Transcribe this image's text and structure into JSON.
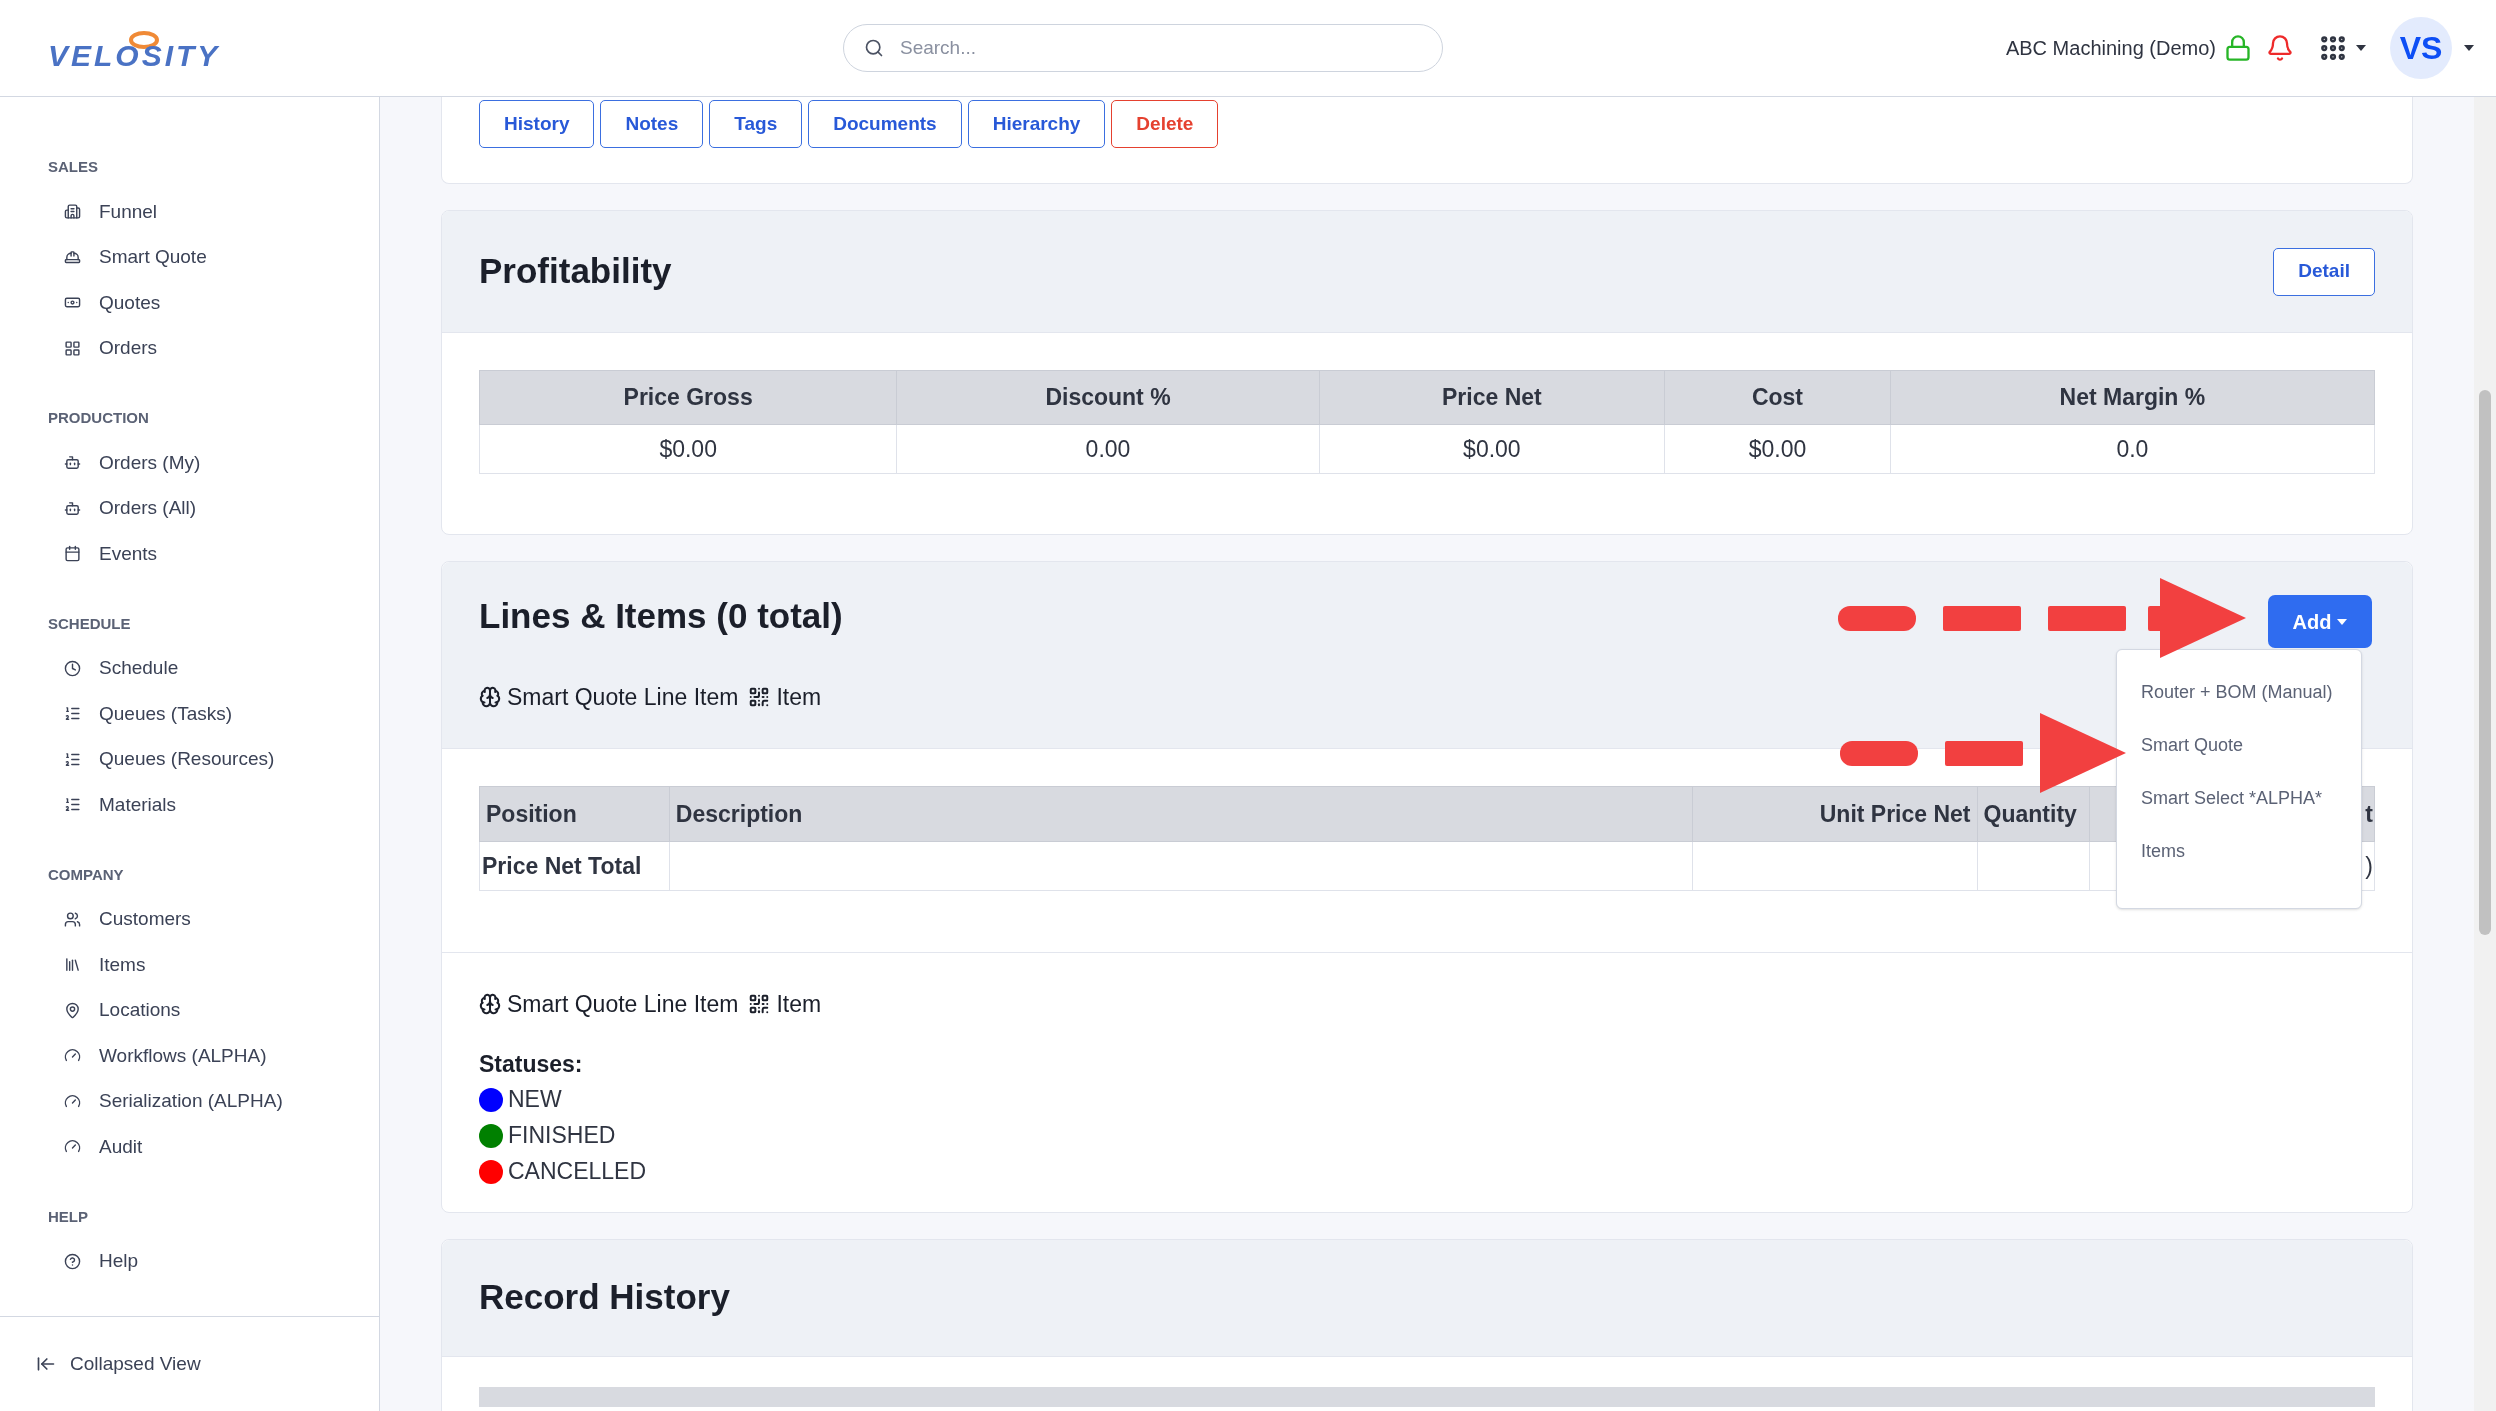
{
  "header": {
    "logo": "VELOSITY",
    "search": {
      "placeholder": "Search..."
    },
    "company": "ABC Machining (Demo)",
    "avatar": "VS"
  },
  "sidebar": {
    "sections": [
      {
        "title": "SALES",
        "items": [
          "Funnel",
          "Smart Quote",
          "Quotes",
          "Orders"
        ]
      },
      {
        "title": "PRODUCTION",
        "items": [
          "Orders (My)",
          "Orders (All)",
          "Events"
        ]
      },
      {
        "title": "SCHEDULE",
        "items": [
          "Schedule",
          "Queues (Tasks)",
          "Queues (Resources)",
          "Materials"
        ]
      },
      {
        "title": "COMPANY",
        "items": [
          "Customers",
          "Items",
          "Locations",
          "Workflows (ALPHA)",
          "Serialization (ALPHA)",
          "Audit"
        ]
      },
      {
        "title": "HELP",
        "items": [
          "Help"
        ]
      }
    ],
    "footer": "Collapsed View"
  },
  "record_buttons": [
    {
      "label": "History",
      "kind": "outline"
    },
    {
      "label": "Notes",
      "kind": "outline"
    },
    {
      "label": "Tags",
      "kind": "outline"
    },
    {
      "label": "Documents",
      "kind": "outline"
    },
    {
      "label": "Hierarchy",
      "kind": "outline"
    },
    {
      "label": "Delete",
      "kind": "danger"
    }
  ],
  "profitability": {
    "title": "Profitability",
    "detail_button": "Detail",
    "columns": [
      "Price Gross",
      "Discount %",
      "Price Net",
      "Cost",
      "Net Margin %"
    ],
    "rows": [
      [
        "$0.00",
        "0.00",
        "$0.00",
        "$0.00",
        "0.0"
      ]
    ]
  },
  "lines": {
    "title": "Lines & Items (0 total)",
    "legend": [
      "Smart Quote Line Item",
      "Item"
    ],
    "add_button": {
      "label": "Add",
      "expanded": true
    },
    "add_menu": [
      "Router + BOM (Manual)",
      "Smart Quote",
      "Smart Select *ALPHA*",
      "Items"
    ],
    "columns": [
      "Position",
      "Description",
      "Unit Price Net",
      "Quantity",
      "t"
    ],
    "total_row": {
      "label": "Price Net Total",
      "column_6": ")"
    },
    "legend_2": [
      "Smart Quote Line Item",
      "Item"
    ],
    "statuses_title": "Statuses:",
    "statuses": [
      {
        "label": "NEW",
        "color": "#0000ff"
      },
      {
        "label": "FINISHED",
        "color": "#008000"
      },
      {
        "label": "CANCELLED",
        "color": "#ff0000"
      }
    ]
  },
  "record_history": {
    "title": "Record History"
  }
}
